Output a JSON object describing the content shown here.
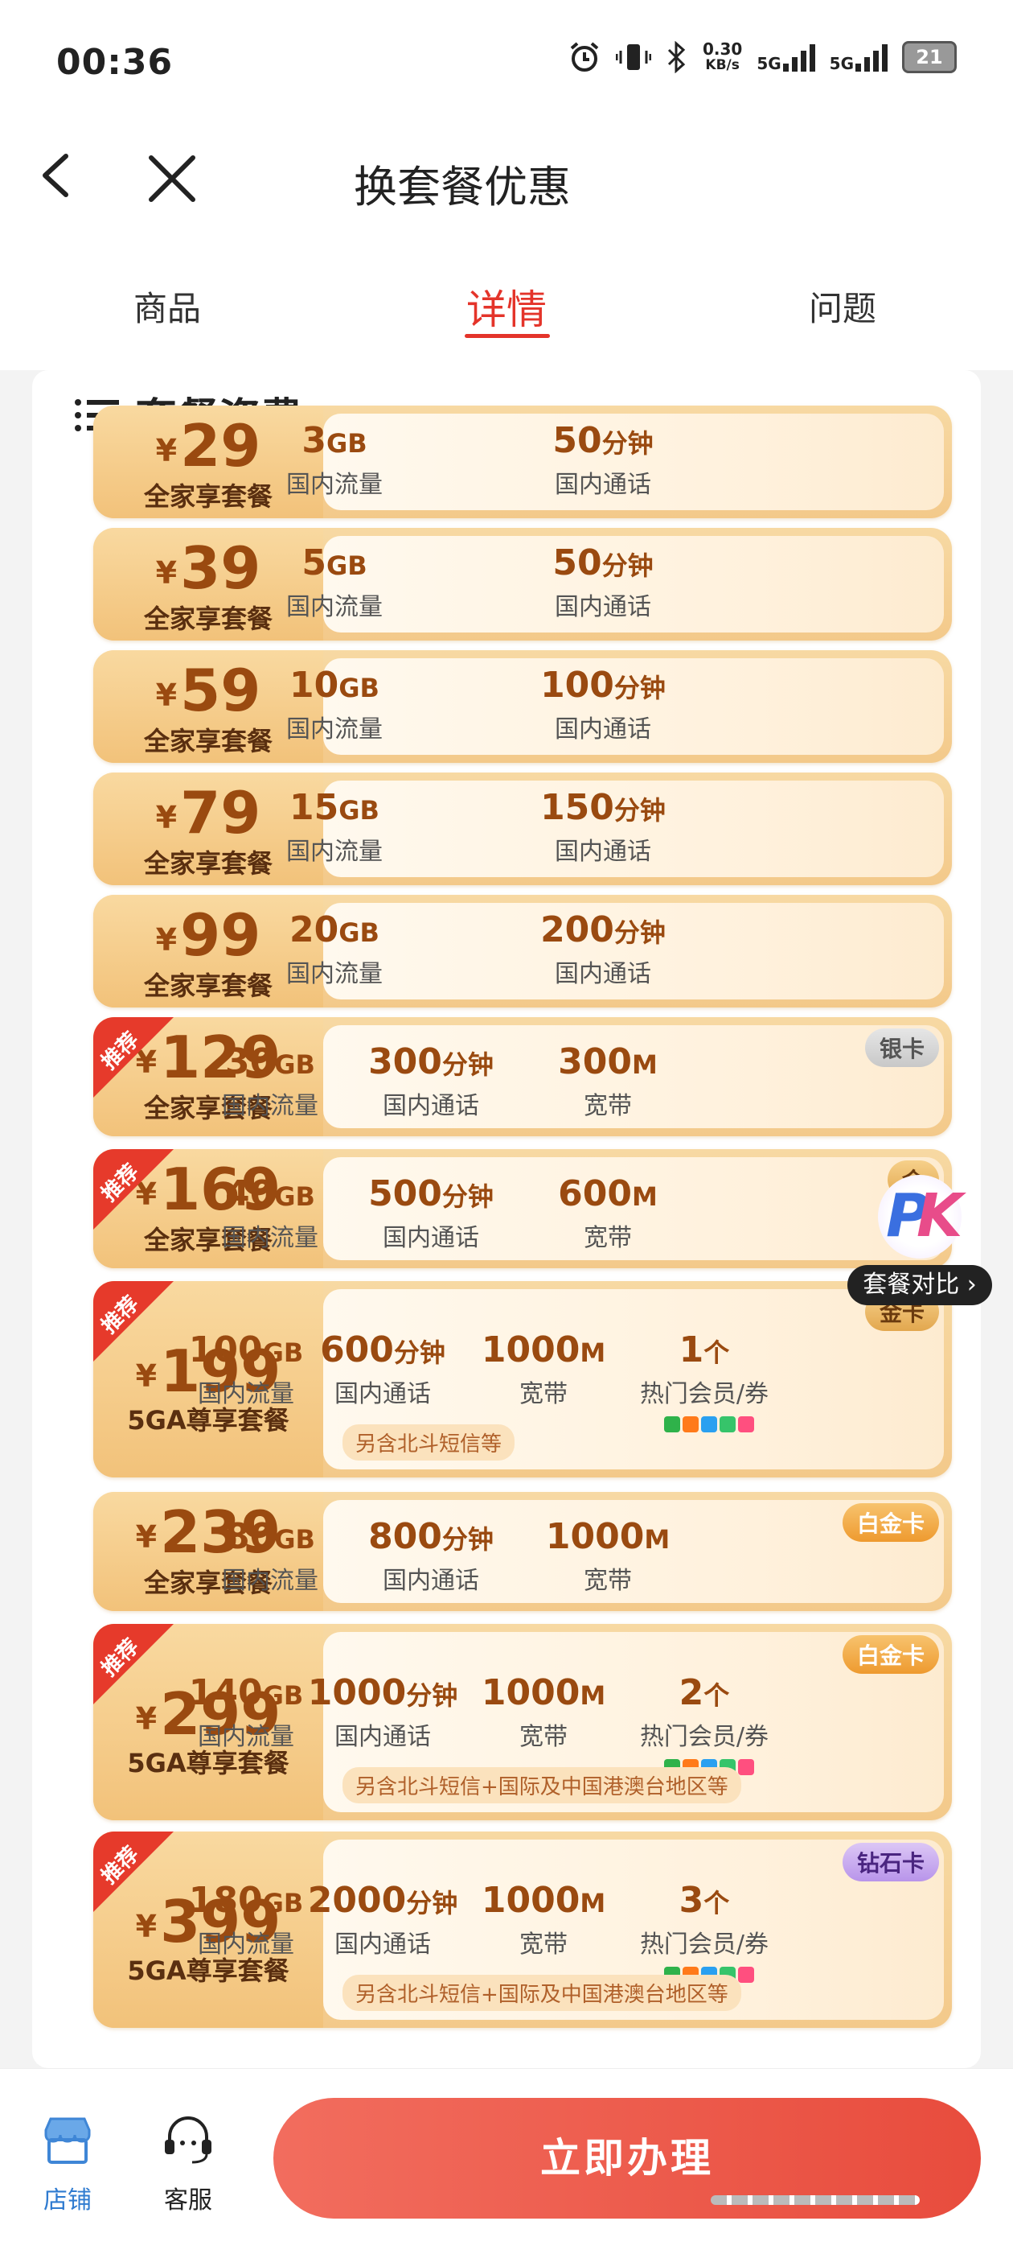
{
  "status_bar": {
    "time": "00:36",
    "speed": "0.30",
    "speed_unit": "KB/s",
    "sim1": "5G",
    "sim2": "5G",
    "battery": "21"
  },
  "header": {
    "title": "换套餐优惠"
  },
  "tabs": [
    {
      "label": "商品"
    },
    {
      "label": "详情"
    },
    {
      "label": "问题"
    }
  ],
  "section_title": "套餐资费",
  "plans": [
    {
      "price": "29",
      "name": "全家享套餐",
      "f": [
        [
          "3",
          "GB",
          "国内流量"
        ],
        [
          "50",
          "分钟",
          "国内通话"
        ]
      ]
    },
    {
      "price": "39",
      "name": "全家享套餐",
      "f": [
        [
          "5",
          "GB",
          "国内流量"
        ],
        [
          "50",
          "分钟",
          "国内通话"
        ]
      ]
    },
    {
      "price": "59",
      "name": "全家享套餐",
      "f": [
        [
          "10",
          "GB",
          "国内流量"
        ],
        [
          "100",
          "分钟",
          "国内通话"
        ]
      ]
    },
    {
      "price": "79",
      "name": "全家享套餐",
      "f": [
        [
          "15",
          "GB",
          "国内流量"
        ],
        [
          "150",
          "分钟",
          "国内通话"
        ]
      ]
    },
    {
      "price": "99",
      "name": "全家享套餐",
      "f": [
        [
          "20",
          "GB",
          "国内流量"
        ],
        [
          "200",
          "分钟",
          "国内通话"
        ]
      ]
    },
    {
      "price": "129",
      "name": "全家享套餐",
      "recommend": "推荐",
      "badge": "银卡",
      "f": [
        [
          "30",
          "GB",
          "国内流量"
        ],
        [
          "300",
          "分钟",
          "国内通话"
        ],
        [
          "300",
          "M",
          "宽带"
        ]
      ]
    },
    {
      "price": "169",
      "name": "全家享套餐",
      "recommend": "推荐",
      "badge": "金",
      "f": [
        [
          "40",
          "GB",
          "国内流量"
        ],
        [
          "500",
          "分钟",
          "国内通话"
        ],
        [
          "600",
          "M",
          "宽带"
        ]
      ]
    },
    {
      "price": "199",
      "name": "5GA尊享套餐",
      "recommend": "推荐",
      "badge": "金卡",
      "note": "另含北斗短信等",
      "f": [
        [
          "100",
          "GB",
          "国内流量"
        ],
        [
          "600",
          "分钟",
          "国内通话"
        ],
        [
          "1000",
          "M",
          "宽带"
        ],
        [
          "1",
          "个",
          "热门会员/券"
        ]
      ]
    },
    {
      "price": "239",
      "name": "全家享套餐",
      "badge": "白金卡",
      "f": [
        [
          "80",
          "GB",
          "国内流量"
        ],
        [
          "800",
          "分钟",
          "国内通话"
        ],
        [
          "1000",
          "M",
          "宽带"
        ]
      ]
    },
    {
      "price": "299",
      "name": "5GA尊享套餐",
      "recommend": "推荐",
      "badge": "白金卡",
      "note": "另含北斗短信+国际及中国港澳台地区等",
      "f": [
        [
          "140",
          "GB",
          "国内流量"
        ],
        [
          "1000",
          "分钟",
          "国内通话"
        ],
        [
          "1000",
          "M",
          "宽带"
        ],
        [
          "2",
          "个",
          "热门会员/券"
        ]
      ]
    },
    {
      "price": "399",
      "name": "5GA尊享套餐",
      "recommend": "推荐",
      "badge": "钻石卡",
      "note": "另含北斗短信+国际及中国港澳台地区等",
      "f": [
        [
          "180",
          "GB",
          "国内流量"
        ],
        [
          "2000",
          "分钟",
          "国内通话"
        ],
        [
          "1000",
          "M",
          "宽带"
        ],
        [
          "3",
          "个",
          "热门会员/券"
        ]
      ]
    }
  ],
  "yen": "¥",
  "pk": {
    "logo": "PK",
    "label": "套餐对比 ›"
  },
  "bottom": {
    "shop": "店铺",
    "service": "客服",
    "cta": "立即办理"
  }
}
